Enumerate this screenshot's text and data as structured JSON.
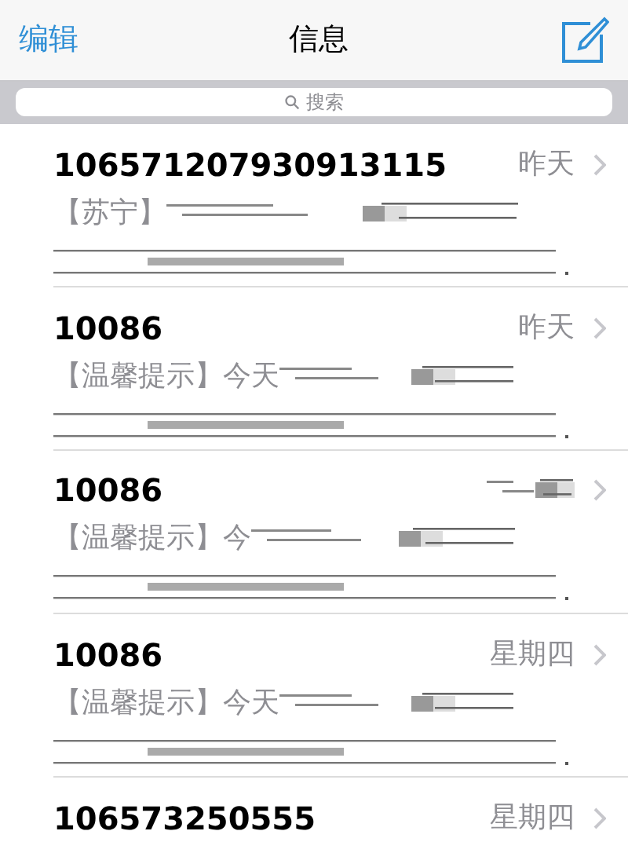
{
  "nav": {
    "edit": "编辑",
    "title": "信息"
  },
  "search": {
    "placeholder": "搜索"
  },
  "messages": [
    {
      "sender": "106571207930913115",
      "date": "昨天",
      "preview": "【苏宁】"
    },
    {
      "sender": "10086",
      "date": "昨天",
      "preview": "【温馨提示】今天"
    },
    {
      "sender": "10086",
      "preview": "【温馨提示】今"
    },
    {
      "sender": "10086",
      "date": "星期四",
      "preview": "【温馨提示】今天"
    },
    {
      "sender": "106573250555",
      "date": "星期四"
    }
  ]
}
